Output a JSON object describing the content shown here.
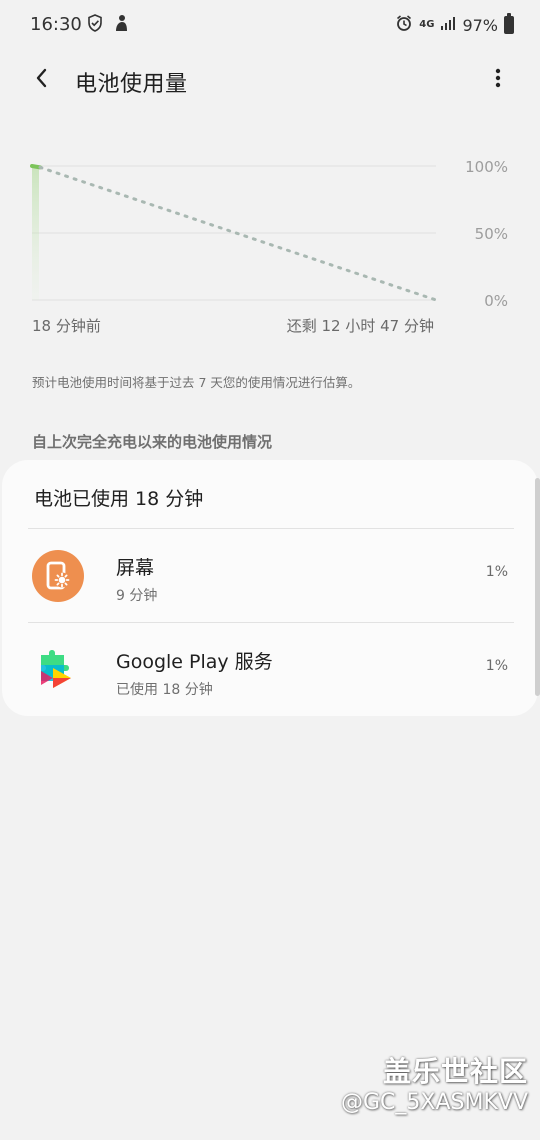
{
  "status_bar": {
    "time": "16:30",
    "network": "4G",
    "battery_percent": "97%",
    "left_icons": [
      "shield-check-icon",
      "person-icon"
    ],
    "right_icons": [
      "alarm-icon",
      "signal-icon",
      "battery-icon"
    ]
  },
  "app_bar": {
    "title": "电池使用量",
    "back_icon": "chevron-left-icon",
    "more_icon": "more-vert-icon"
  },
  "chart_data": {
    "type": "line",
    "x_labels": [
      "18 分钟前",
      "还剩 12 小时 47 分钟"
    ],
    "y_ticks": [
      "100%",
      "50%",
      "0%"
    ],
    "ylim": [
      0,
      100
    ],
    "series": [
      {
        "values": [
          100,
          99
        ],
        "color": "#7cc45a"
      },
      {
        "values": [
          99,
          0
        ],
        "color": "#a9b8b2"
      }
    ]
  },
  "chart": {
    "left_label": "18 分钟前",
    "right_label": "还剩 12 小时 47 分钟"
  },
  "note": "预计电池使用时间将基于过去 7 天您的使用情况进行估算。",
  "section_header": "自上次完全充电以来的电池使用情况",
  "card": {
    "title": "电池已使用 18 分钟",
    "items": [
      {
        "name": "屏幕",
        "detail": "9 分钟",
        "percent": "1%",
        "icon": "screen-brightness-icon",
        "icon_color": "#ee8f4f"
      },
      {
        "name": "Google Play 服务",
        "detail": "已使用 18 分钟",
        "percent": "1%",
        "icon": "puzzle-icon"
      }
    ]
  },
  "watermark": {
    "brand": "盖乐世社区",
    "user": "@GC_5XASMKVV"
  }
}
